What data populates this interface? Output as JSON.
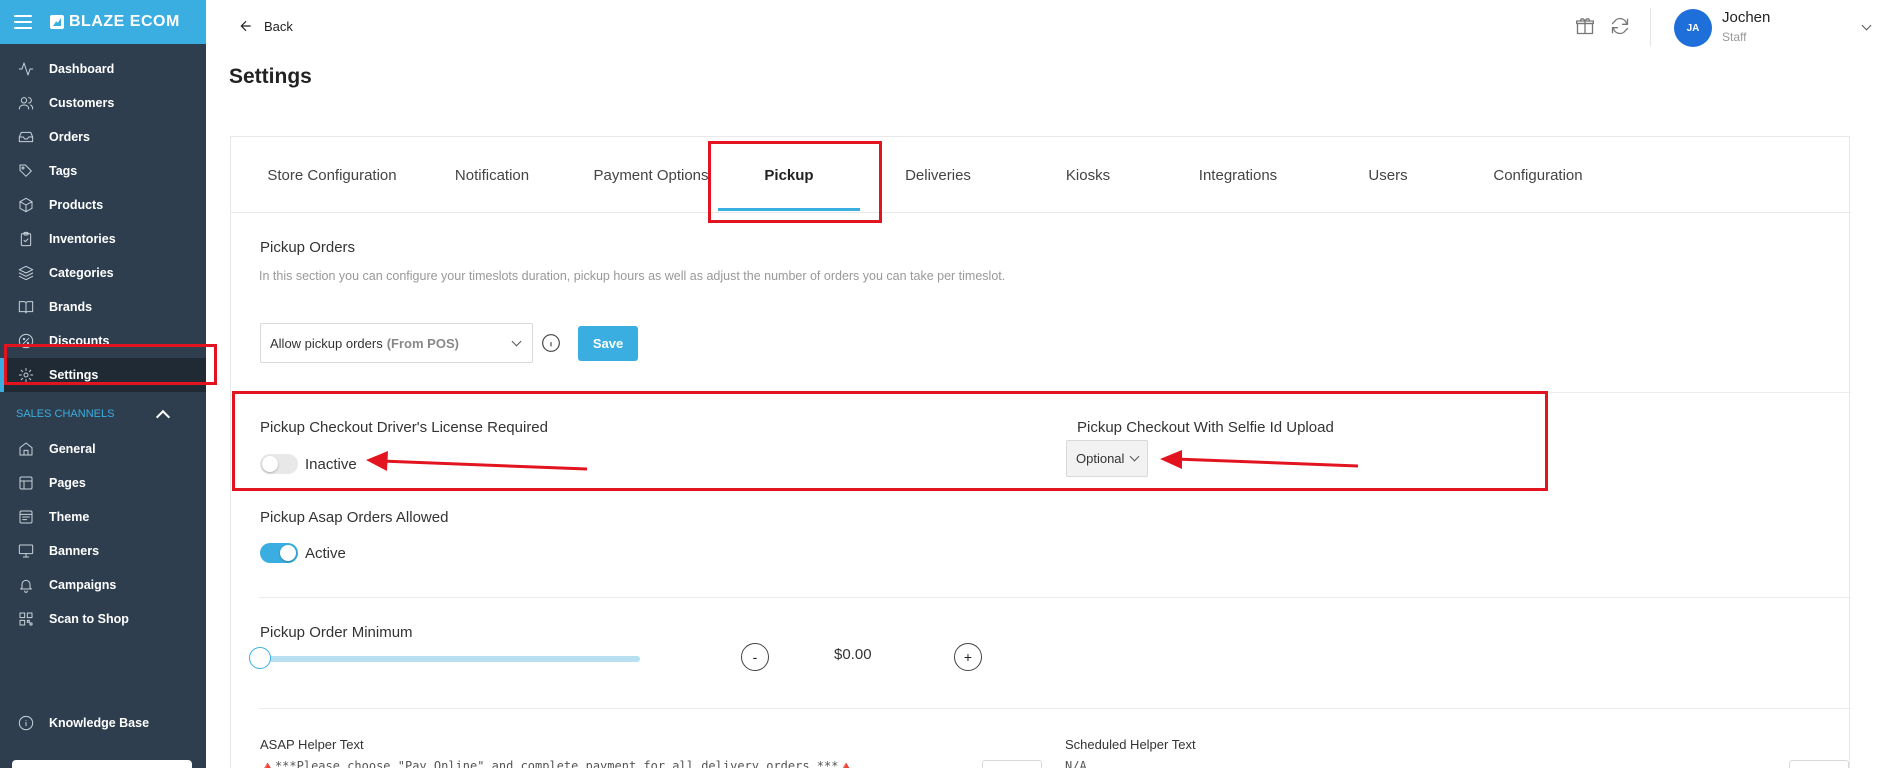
{
  "app": {
    "brand": "BLAZE ECOM"
  },
  "sidebar": {
    "items": [
      {
        "label": "Dashboard",
        "icon": "activity-icon"
      },
      {
        "label": "Customers",
        "icon": "users-icon"
      },
      {
        "label": "Orders",
        "icon": "inbox-icon"
      },
      {
        "label": "Tags",
        "icon": "tag-icon"
      },
      {
        "label": "Products",
        "icon": "box-icon"
      },
      {
        "label": "Inventories",
        "icon": "clipboard-icon"
      },
      {
        "label": "Categories",
        "icon": "layers-icon"
      },
      {
        "label": "Brands",
        "icon": "book-icon"
      },
      {
        "label": "Discounts",
        "icon": "percent-icon"
      },
      {
        "label": "Settings",
        "icon": "gear-icon",
        "active": true
      }
    ],
    "sales_channels_label": "SALES CHANNELS",
    "channels": [
      {
        "label": "General",
        "icon": "home-icon"
      },
      {
        "label": "Pages",
        "icon": "pages-icon"
      },
      {
        "label": "Theme",
        "icon": "theme-icon"
      },
      {
        "label": "Banners",
        "icon": "monitor-icon"
      },
      {
        "label": "Campaigns",
        "icon": "bell-icon"
      },
      {
        "label": "Scan to Shop",
        "icon": "qr-icon"
      }
    ],
    "knowledge_base": "Knowledge Base"
  },
  "topbar": {
    "back_label": "Back",
    "user": {
      "initials": "JA",
      "name": "Jochen",
      "role": "Staff"
    }
  },
  "page": {
    "title": "Settings"
  },
  "tabs": [
    {
      "label": "Store Configuration"
    },
    {
      "label": "Notification"
    },
    {
      "label": "Payment Options"
    },
    {
      "label": "Pickup",
      "active": true
    },
    {
      "label": "Deliveries"
    },
    {
      "label": "Kiosks"
    },
    {
      "label": "Integrations"
    },
    {
      "label": "Users"
    },
    {
      "label": "Configuration"
    }
  ],
  "pickup": {
    "orders_title": "Pickup Orders",
    "orders_desc": "In this section you can configure your timeslots duration, pickup hours as well as adjust the number of orders you can take per timeslot.",
    "allow_select": {
      "value": "Allow pickup orders",
      "hint": "(From POS)"
    },
    "save_label": "Save",
    "license_title": "Pickup Checkout Driver's License Required",
    "license_status": "Inactive",
    "license_on": false,
    "selfie_title": "Pickup Checkout With Selfie Id Upload",
    "selfie_value": "Optional",
    "asap_title": "Pickup Asap Orders Allowed",
    "asap_status": "Active",
    "asap_on": true,
    "minimum_title": "Pickup Order Minimum",
    "minimum_value": "$0.00",
    "minimum_fraction": 0,
    "minus_label": "-",
    "plus_label": "+",
    "asap_helper_label": "ASAP Helper Text",
    "asap_helper_text": "🔺***Please choose \"Pay Online\" and complete payment for all delivery orders.***🔺",
    "scheduled_helper_label": "Scheduled Helper Text",
    "scheduled_helper_text": "N/A"
  },
  "colors": {
    "accent": "#3aaee0",
    "sidebar": "#2e3e4e",
    "annotation": "#e2141f"
  }
}
